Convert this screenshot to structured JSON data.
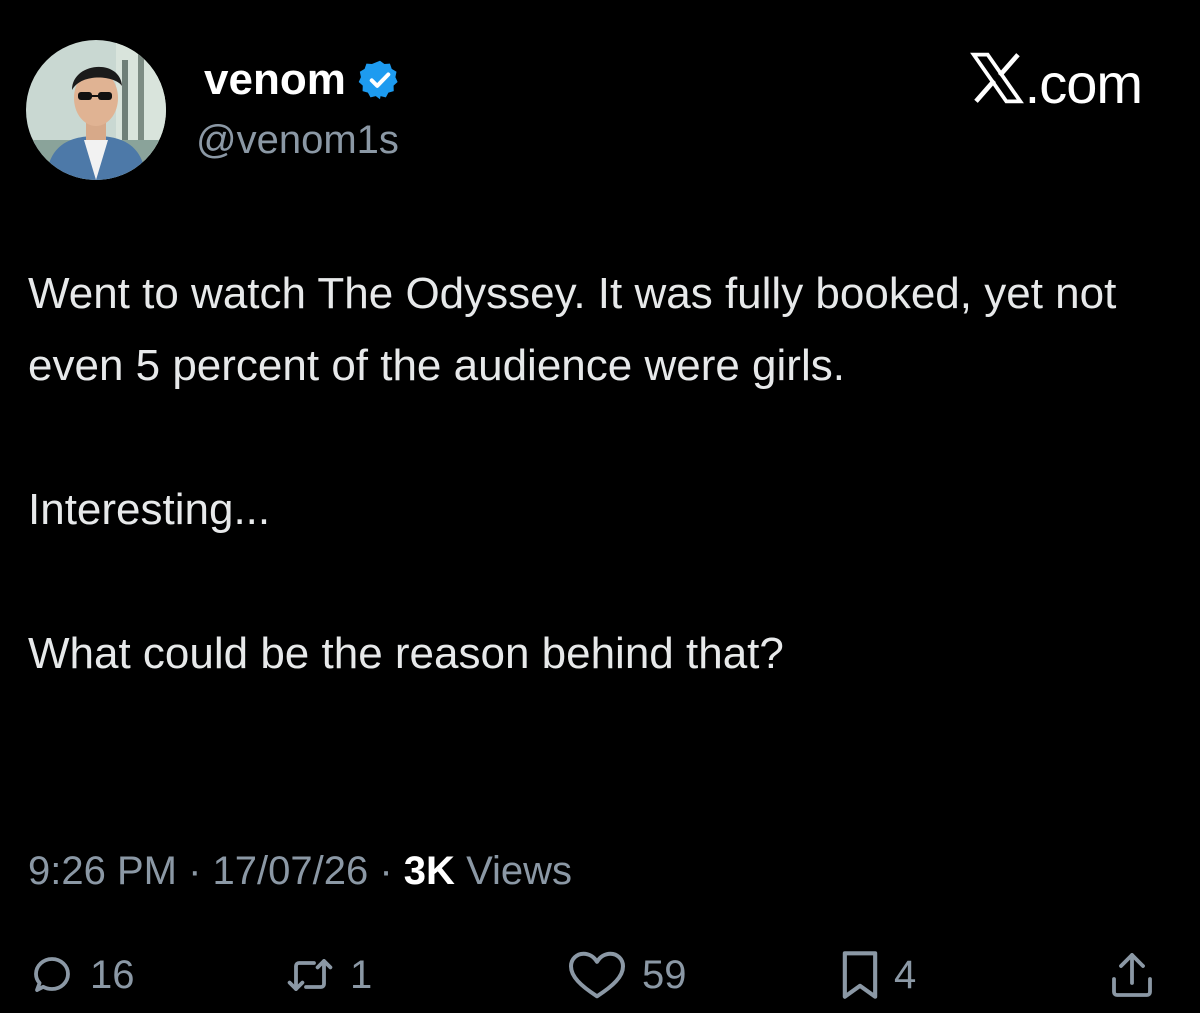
{
  "author": {
    "display_name": "venom",
    "handle": "@venom1s",
    "verified": true,
    "verified_color": "#1d9bf0"
  },
  "site": {
    "name": ".com",
    "logo_icon": "x-logo-icon"
  },
  "tweet": {
    "paragraphs": [
      "Went to watch The Odyssey. It was fully booked, yet not even 5 percent of the audience were girls.",
      "Interesting...",
      "What could be the reason behind that?"
    ],
    "time": "9:26 PM",
    "date": "17/07/26",
    "views_count": "3K",
    "views_label": "Views"
  },
  "actions": {
    "replies": "16",
    "reposts": "1",
    "likes": "59",
    "bookmarks": "4"
  },
  "colors": {
    "background": "#000000",
    "text": "#e7e9ea",
    "secondary": "#8b98a5"
  }
}
